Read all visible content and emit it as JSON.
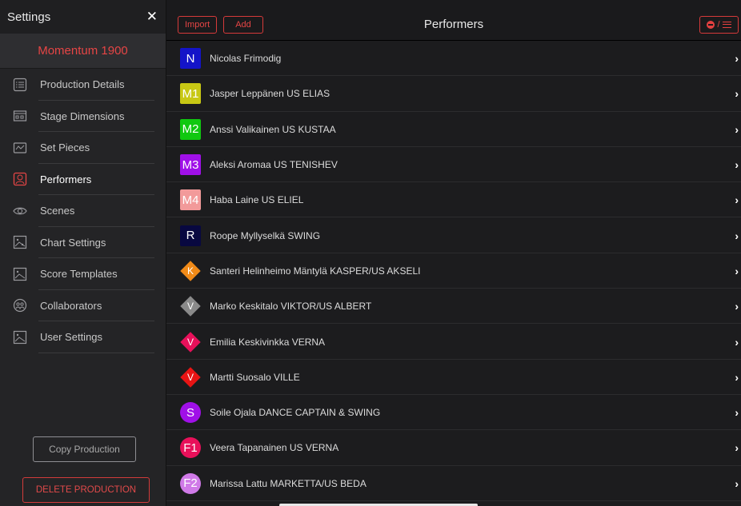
{
  "sidebar": {
    "title": "Settings",
    "close_glyph": "✕",
    "production_name": "Momentum 1900",
    "items": [
      {
        "label": "Production Details",
        "icon": "list-icon"
      },
      {
        "label": "Stage Dimensions",
        "icon": "stage-icon"
      },
      {
        "label": "Set Pieces",
        "icon": "set-pieces-icon"
      },
      {
        "label": "Performers",
        "icon": "performer-icon",
        "active": true
      },
      {
        "label": "Scenes",
        "icon": "eye-icon"
      },
      {
        "label": "Chart Settings",
        "icon": "chart-icon"
      },
      {
        "label": "Score Templates",
        "icon": "score-icon"
      },
      {
        "label": "Collaborators",
        "icon": "collaborators-icon"
      },
      {
        "label": "User Settings",
        "icon": "user-settings-icon"
      }
    ],
    "copy_label": "Copy Production",
    "delete_label": "DELETE PRODUCTION"
  },
  "header": {
    "import_label": "Import",
    "add_label": "Add",
    "title": "Performers",
    "toggle_slash": "/"
  },
  "performers": [
    {
      "badge": "N",
      "shape": "square",
      "color": "#1414c8",
      "name": "Nicolas Frimodig"
    },
    {
      "badge": "M1",
      "shape": "square",
      "color": "#c8c814",
      "name": "Jasper Leppänen US ELIAS"
    },
    {
      "badge": "M2",
      "shape": "square",
      "color": "#10c810",
      "name": "Anssi Valikainen US KUSTAA"
    },
    {
      "badge": "M3",
      "shape": "square",
      "color": "#a010e8",
      "name": "Aleksi Aromaa US TENISHEV"
    },
    {
      "badge": "M4",
      "shape": "square",
      "color": "#f29a9a",
      "name": "Haba Laine US ELIEL"
    },
    {
      "badge": "R",
      "shape": "square",
      "color": "#080840",
      "name": "Roope Myllyselkä SWING"
    },
    {
      "badge": "K",
      "shape": "diamond",
      "color": "#f08a18",
      "name": "Santeri Helinheimo Mäntylä KASPER/US AKSELI"
    },
    {
      "badge": "V",
      "shape": "diamond",
      "color": "#8a8a8a",
      "name": "Marko Keskitalo VIKTOR/US ALBERT"
    },
    {
      "badge": "V",
      "shape": "diamond",
      "color": "#e8105a",
      "name": "Emilia Keskivinkka VERNA"
    },
    {
      "badge": "V",
      "shape": "diamond",
      "color": "#e81414",
      "name": "Martti Suosalo VILLE"
    },
    {
      "badge": "S",
      "shape": "circle",
      "color": "#a010e8",
      "name": "Soile Ojala DANCE CAPTAIN & SWING"
    },
    {
      "badge": "F1",
      "shape": "circle",
      "color": "#e8105a",
      "name": "Veera Tapanainen US VERNA"
    },
    {
      "badge": "F2",
      "shape": "circle",
      "color": "#d07ae8",
      "name": "Marissa Lattu MARKETTA/US BEDA"
    }
  ],
  "chevron": "›",
  "colors": {
    "accent": "#e64545",
    "background": "#1c1c1e",
    "sidebar": "#242426"
  }
}
